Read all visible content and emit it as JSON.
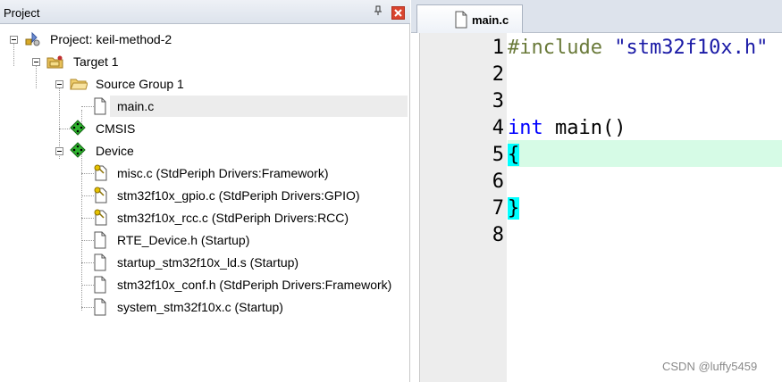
{
  "project_panel": {
    "title": "Project",
    "pin_glyph": "↑",
    "close_glyph": "x",
    "tree": {
      "root": {
        "label": "Project: keil-method-2",
        "icon": "project-icon"
      },
      "target": {
        "label": "Target 1",
        "icon": "target-folder-icon"
      },
      "source_group": {
        "label": "Source Group 1",
        "icon": "folder-icon"
      },
      "main_file": {
        "label": "main.c",
        "icon": "file-icon"
      },
      "cmsis": {
        "label": "CMSIS",
        "icon": "green-diamond-icon"
      },
      "device": {
        "label": "Device",
        "icon": "green-diamond-icon"
      },
      "device_files": [
        {
          "label": "misc.c (StdPeriph Drivers:Framework)",
          "icon": "key-file-icon"
        },
        {
          "label": "stm32f10x_gpio.c (StdPeriph Drivers:GPIO)",
          "icon": "key-file-icon"
        },
        {
          "label": "stm32f10x_rcc.c (StdPeriph Drivers:RCC)",
          "icon": "key-file-icon"
        },
        {
          "label": "RTE_Device.h (Startup)",
          "icon": "file-icon"
        },
        {
          "label": "startup_stm32f10x_ld.s (Startup)",
          "icon": "file-icon"
        },
        {
          "label": "stm32f10x_conf.h (StdPeriph Drivers:Framework)",
          "icon": "file-icon"
        },
        {
          "label": "system_stm32f10x.c (Startup)",
          "icon": "file-icon"
        }
      ]
    }
  },
  "editor": {
    "tab": {
      "label": "main.c",
      "icon": "file-icon"
    },
    "line_numbers": [
      "1",
      "2",
      "3",
      "4",
      "5",
      "6",
      "7",
      "8"
    ],
    "code": {
      "line1_directive": "#include",
      "line1_string": "\"stm32f10x.h\"",
      "line4_type": "int",
      "line4_rest": " main()",
      "line5_brace": "{",
      "line7_brace": "}"
    },
    "current_line": 5,
    "colors": {
      "directive": "#6a7a3a",
      "string": "#1a1aa6",
      "keyword": "#0000ff",
      "current_line_bg": "#d6fbe6",
      "brace_match_bg": "#00ffff"
    }
  },
  "watermark": "CSDN @luffy5459"
}
